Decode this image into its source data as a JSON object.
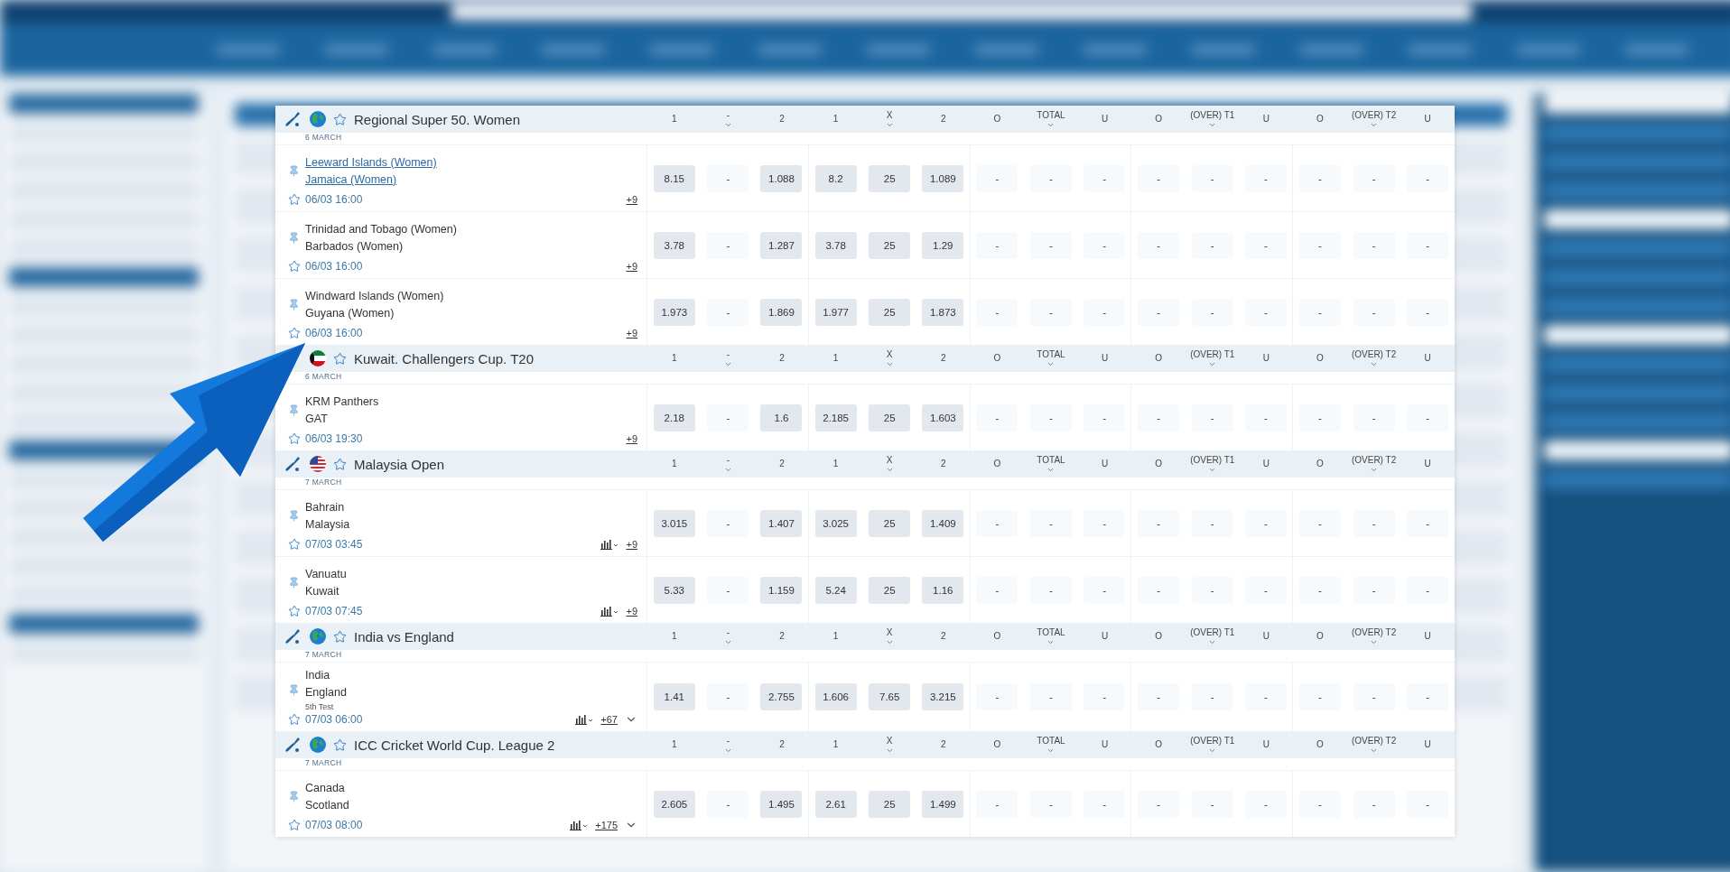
{
  "groups": [
    {
      "title": "Regional Super 50. Women",
      "date": "6 MARCH",
      "sport_icon": true,
      "kind": "world",
      "columns": [
        {
          "label": "1",
          "dropdown": false
        },
        {
          "label": "-",
          "dropdown": true
        },
        {
          "label": "2",
          "dropdown": false
        },
        {
          "label": "1",
          "dropdown": false
        },
        {
          "label": "X",
          "dropdown": true
        },
        {
          "label": "2",
          "dropdown": false
        },
        {
          "label": "O",
          "dropdown": false
        },
        {
          "label": "TOTAL",
          "dropdown": true
        },
        {
          "label": "U",
          "dropdown": false
        },
        {
          "label": "O",
          "dropdown": false
        },
        {
          "label": "(OVER) T1",
          "dropdown": true
        },
        {
          "label": "U",
          "dropdown": false
        },
        {
          "label": "O",
          "dropdown": false
        },
        {
          "label": "(OVER) T2",
          "dropdown": true
        },
        {
          "label": "U",
          "dropdown": false
        }
      ],
      "matches": [
        {
          "team1": "Leeward Islands (Women)",
          "team2": "Jamaica (Women)",
          "time": "06/03 16:00",
          "more": "+9",
          "hovered": true,
          "stats": false,
          "expand": false,
          "odds": [
            {
              "v": "8.15",
              "on": true
            },
            {
              "v": "-",
              "on": false
            },
            {
              "v": "1.088",
              "on": true
            },
            {
              "v": "8.2",
              "on": true
            },
            {
              "v": "25",
              "on": true
            },
            {
              "v": "1.089",
              "on": true
            },
            {
              "v": "-",
              "on": false
            },
            {
              "v": "-",
              "on": false
            },
            {
              "v": "-",
              "on": false
            },
            {
              "v": "-",
              "on": false
            },
            {
              "v": "-",
              "on": false
            },
            {
              "v": "-",
              "on": false
            },
            {
              "v": "-",
              "on": false
            },
            {
              "v": "-",
              "on": false
            },
            {
              "v": "-",
              "on": false
            }
          ]
        },
        {
          "team1": "Trinidad and Tobago (Women)",
          "team2": "Barbados (Women)",
          "time": "06/03 16:00",
          "more": "+9",
          "hovered": false,
          "stats": false,
          "expand": false,
          "odds": [
            {
              "v": "3.78",
              "on": true
            },
            {
              "v": "-",
              "on": false
            },
            {
              "v": "1.287",
              "on": true
            },
            {
              "v": "3.78",
              "on": true
            },
            {
              "v": "25",
              "on": true
            },
            {
              "v": "1.29",
              "on": true
            },
            {
              "v": "-",
              "on": false
            },
            {
              "v": "-",
              "on": false
            },
            {
              "v": "-",
              "on": false
            },
            {
              "v": "-",
              "on": false
            },
            {
              "v": "-",
              "on": false
            },
            {
              "v": "-",
              "on": false
            },
            {
              "v": "-",
              "on": false
            },
            {
              "v": "-",
              "on": false
            },
            {
              "v": "-",
              "on": false
            }
          ]
        },
        {
          "team1": "Windward Islands (Women)",
          "team2": "Guyana (Women)",
          "time": "06/03 16:00",
          "more": "+9",
          "hovered": false,
          "stats": false,
          "expand": false,
          "odds": [
            {
              "v": "1.973",
              "on": true
            },
            {
              "v": "-",
              "on": false
            },
            {
              "v": "1.869",
              "on": true
            },
            {
              "v": "1.977",
              "on": true
            },
            {
              "v": "25",
              "on": true
            },
            {
              "v": "1.873",
              "on": true
            },
            {
              "v": "-",
              "on": false
            },
            {
              "v": "-",
              "on": false
            },
            {
              "v": "-",
              "on": false
            },
            {
              "v": "-",
              "on": false
            },
            {
              "v": "-",
              "on": false
            },
            {
              "v": "-",
              "on": false
            },
            {
              "v": "-",
              "on": false
            },
            {
              "v": "-",
              "on": false
            },
            {
              "v": "-",
              "on": false
            }
          ]
        }
      ]
    },
    {
      "title": "Kuwait. Challengers Cup. T20",
      "date": "6 MARCH",
      "sport_icon": false,
      "kind": "kuwait",
      "columns": [
        {
          "label": "1",
          "dropdown": false
        },
        {
          "label": "-",
          "dropdown": true
        },
        {
          "label": "2",
          "dropdown": false
        },
        {
          "label": "1",
          "dropdown": false
        },
        {
          "label": "X",
          "dropdown": true
        },
        {
          "label": "2",
          "dropdown": false
        },
        {
          "label": "O",
          "dropdown": false
        },
        {
          "label": "TOTAL",
          "dropdown": true
        },
        {
          "label": "U",
          "dropdown": false
        },
        {
          "label": "O",
          "dropdown": false
        },
        {
          "label": "(OVER) T1",
          "dropdown": true
        },
        {
          "label": "U",
          "dropdown": false
        },
        {
          "label": "O",
          "dropdown": false
        },
        {
          "label": "(OVER) T2",
          "dropdown": true
        },
        {
          "label": "U",
          "dropdown": false
        }
      ],
      "matches": [
        {
          "team1": "KRM Panthers",
          "team2": "GAT",
          "time": "06/03 19:30",
          "more": "+9",
          "hovered": false,
          "stats": false,
          "expand": false,
          "odds": [
            {
              "v": "2.18",
              "on": true
            },
            {
              "v": "-",
              "on": false
            },
            {
              "v": "1.6",
              "on": true
            },
            {
              "v": "2.185",
              "on": true
            },
            {
              "v": "25",
              "on": true
            },
            {
              "v": "1.603",
              "on": true
            },
            {
              "v": "-",
              "on": false
            },
            {
              "v": "-",
              "on": false
            },
            {
              "v": "-",
              "on": false
            },
            {
              "v": "-",
              "on": false
            },
            {
              "v": "-",
              "on": false
            },
            {
              "v": "-",
              "on": false
            },
            {
              "v": "-",
              "on": false
            },
            {
              "v": "-",
              "on": false
            },
            {
              "v": "-",
              "on": false
            }
          ]
        }
      ]
    },
    {
      "title": "Malaysia Open",
      "date": "7 MARCH",
      "sport_icon": true,
      "kind": "usa",
      "columns": [
        {
          "label": "1",
          "dropdown": false
        },
        {
          "label": "-",
          "dropdown": true
        },
        {
          "label": "2",
          "dropdown": false
        },
        {
          "label": "1",
          "dropdown": false
        },
        {
          "label": "X",
          "dropdown": true
        },
        {
          "label": "2",
          "dropdown": false
        },
        {
          "label": "O",
          "dropdown": false
        },
        {
          "label": "TOTAL",
          "dropdown": true
        },
        {
          "label": "U",
          "dropdown": false
        },
        {
          "label": "O",
          "dropdown": false
        },
        {
          "label": "(OVER) T1",
          "dropdown": true
        },
        {
          "label": "U",
          "dropdown": false
        },
        {
          "label": "O",
          "dropdown": false
        },
        {
          "label": "(OVER) T2",
          "dropdown": true
        },
        {
          "label": "U",
          "dropdown": false
        }
      ],
      "matches": [
        {
          "team1": "Bahrain",
          "team2": "Malaysia",
          "time": "07/03 03:45",
          "more": "+9",
          "hovered": false,
          "stats": true,
          "expand": false,
          "odds": [
            {
              "v": "3.015",
              "on": true
            },
            {
              "v": "-",
              "on": false
            },
            {
              "v": "1.407",
              "on": true
            },
            {
              "v": "3.025",
              "on": true
            },
            {
              "v": "25",
              "on": true
            },
            {
              "v": "1.409",
              "on": true
            },
            {
              "v": "-",
              "on": false
            },
            {
              "v": "-",
              "on": false
            },
            {
              "v": "-",
              "on": false
            },
            {
              "v": "-",
              "on": false
            },
            {
              "v": "-",
              "on": false
            },
            {
              "v": "-",
              "on": false
            },
            {
              "v": "-",
              "on": false
            },
            {
              "v": "-",
              "on": false
            },
            {
              "v": "-",
              "on": false
            }
          ]
        },
        {
          "team1": "Vanuatu",
          "team2": "Kuwait",
          "time": "07/03 07:45",
          "more": "+9",
          "hovered": false,
          "stats": true,
          "expand": false,
          "odds": [
            {
              "v": "5.33",
              "on": true
            },
            {
              "v": "-",
              "on": false
            },
            {
              "v": "1.159",
              "on": true
            },
            {
              "v": "5.24",
              "on": true
            },
            {
              "v": "25",
              "on": true
            },
            {
              "v": "1.16",
              "on": true
            },
            {
              "v": "-",
              "on": false
            },
            {
              "v": "-",
              "on": false
            },
            {
              "v": "-",
              "on": false
            },
            {
              "v": "-",
              "on": false
            },
            {
              "v": "-",
              "on": false
            },
            {
              "v": "-",
              "on": false
            },
            {
              "v": "-",
              "on": false
            },
            {
              "v": "-",
              "on": false
            },
            {
              "v": "-",
              "on": false
            }
          ]
        }
      ]
    },
    {
      "title": "India vs England",
      "date": "7 MARCH",
      "sport_icon": true,
      "kind": "world",
      "columns": [
        {
          "label": "1",
          "dropdown": false
        },
        {
          "label": "-",
          "dropdown": true
        },
        {
          "label": "2",
          "dropdown": false
        },
        {
          "label": "1",
          "dropdown": false
        },
        {
          "label": "X",
          "dropdown": true
        },
        {
          "label": "2",
          "dropdown": false
        },
        {
          "label": "O",
          "dropdown": false
        },
        {
          "label": "TOTAL",
          "dropdown": true
        },
        {
          "label": "U",
          "dropdown": false
        },
        {
          "label": "O",
          "dropdown": false
        },
        {
          "label": "(OVER) T1",
          "dropdown": true
        },
        {
          "label": "U",
          "dropdown": false
        },
        {
          "label": "O",
          "dropdown": false
        },
        {
          "label": "(OVER) T2",
          "dropdown": true
        },
        {
          "label": "U",
          "dropdown": false
        }
      ],
      "matches": [
        {
          "team1": "India",
          "team2": "England",
          "note": "5th Test",
          "time": "07/03 06:00",
          "more": "+67",
          "hovered": false,
          "stats": true,
          "expand": true,
          "odds": [
            {
              "v": "1.41",
              "on": true
            },
            {
              "v": "-",
              "on": false
            },
            {
              "v": "2.755",
              "on": true
            },
            {
              "v": "1.606",
              "on": true
            },
            {
              "v": "7.65",
              "on": true
            },
            {
              "v": "3.215",
              "on": true
            },
            {
              "v": "-",
              "on": false
            },
            {
              "v": "-",
              "on": false
            },
            {
              "v": "-",
              "on": false
            },
            {
              "v": "-",
              "on": false
            },
            {
              "v": "-",
              "on": false
            },
            {
              "v": "-",
              "on": false
            },
            {
              "v": "-",
              "on": false
            },
            {
              "v": "-",
              "on": false
            },
            {
              "v": "-",
              "on": false
            }
          ]
        }
      ]
    },
    {
      "title": "ICC Cricket World Cup. League 2",
      "date": "7 MARCH",
      "sport_icon": true,
      "kind": "world",
      "columns": [
        {
          "label": "1",
          "dropdown": false
        },
        {
          "label": "-",
          "dropdown": true
        },
        {
          "label": "2",
          "dropdown": false
        },
        {
          "label": "1",
          "dropdown": false
        },
        {
          "label": "X",
          "dropdown": true
        },
        {
          "label": "2",
          "dropdown": false
        },
        {
          "label": "O",
          "dropdown": false
        },
        {
          "label": "TOTAL",
          "dropdown": true
        },
        {
          "label": "U",
          "dropdown": false
        },
        {
          "label": "O",
          "dropdown": false
        },
        {
          "label": "(OVER) T1",
          "dropdown": true
        },
        {
          "label": "U",
          "dropdown": false
        },
        {
          "label": "O",
          "dropdown": false
        },
        {
          "label": "(OVER) T2",
          "dropdown": true
        },
        {
          "label": "U",
          "dropdown": false
        }
      ],
      "matches": [
        {
          "team1": "Canada",
          "team2": "Scotland",
          "time": "07/03 08:00",
          "more": "+175",
          "hovered": false,
          "stats": true,
          "expand": true,
          "odds": [
            {
              "v": "2.605",
              "on": true
            },
            {
              "v": "-",
              "on": false
            },
            {
              "v": "1.495",
              "on": true
            },
            {
              "v": "2.61",
              "on": true
            },
            {
              "v": "25",
              "on": true
            },
            {
              "v": "1.499",
              "on": true
            },
            {
              "v": "-",
              "on": false
            },
            {
              "v": "-",
              "on": false
            },
            {
              "v": "-",
              "on": false
            },
            {
              "v": "-",
              "on": false
            },
            {
              "v": "-",
              "on": false
            },
            {
              "v": "-",
              "on": false
            },
            {
              "v": "-",
              "on": false
            },
            {
              "v": "-",
              "on": false
            },
            {
              "v": "-",
              "on": false
            }
          ]
        }
      ]
    }
  ]
}
